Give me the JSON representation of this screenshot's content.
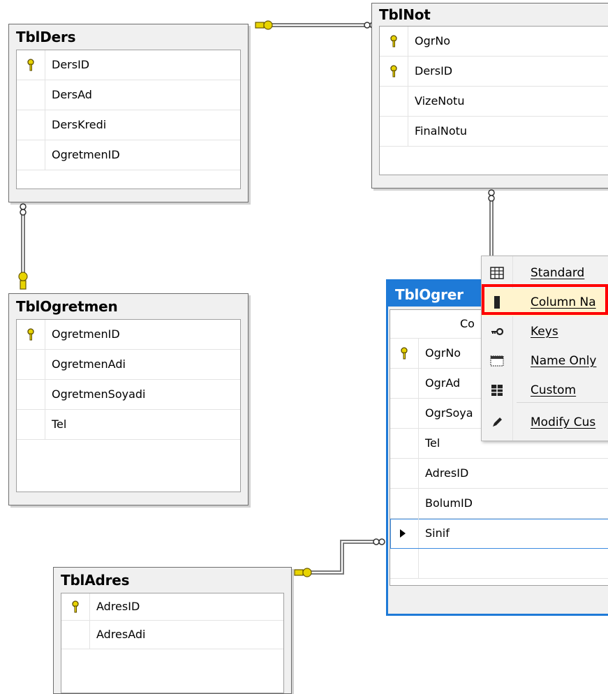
{
  "tables": {
    "tblders": {
      "title": "TblDers",
      "columns": [
        "DersID",
        "DersAd",
        "DersKredi",
        "OgretmenID"
      ]
    },
    "tblnot": {
      "title": "TblNot",
      "columns": [
        "OgrNo",
        "DersID",
        "VizeNotu",
        "FinalNotu"
      ]
    },
    "tblogretmen": {
      "title": "TblOgretmen",
      "columns": [
        "OgretmenID",
        "OgretmenAdi",
        "OgretmenSoyadi",
        "Tel"
      ]
    },
    "tbladres": {
      "title": "TblAdres",
      "columns": [
        "AdresID",
        "AdresAdi"
      ]
    },
    "tblogrenci": {
      "title": "TblOgrer",
      "header_fragment": "Co",
      "columns": [
        "OgrNo",
        "OgrAd",
        "OgrSoya",
        "Tel",
        "AdresID",
        "BolumID",
        "Sinif"
      ]
    }
  },
  "context_menu": {
    "items": [
      {
        "label": "Standard",
        "icon": "grid-icon"
      },
      {
        "label": "Column Na",
        "icon": "column-icon"
      },
      {
        "label": "Keys",
        "icon": "key-icon"
      },
      {
        "label": "Name Only",
        "icon": "name-only-icon"
      },
      {
        "label": "Custom",
        "icon": "custom-grid-icon"
      },
      {
        "label": "Modify Cus",
        "icon": "pencil-icon"
      }
    ],
    "highlighted": "Column Na"
  },
  "colors": {
    "selected_table": "#1e7ad7",
    "highlight": "#ff0000",
    "key_gold": "#d8c000"
  }
}
